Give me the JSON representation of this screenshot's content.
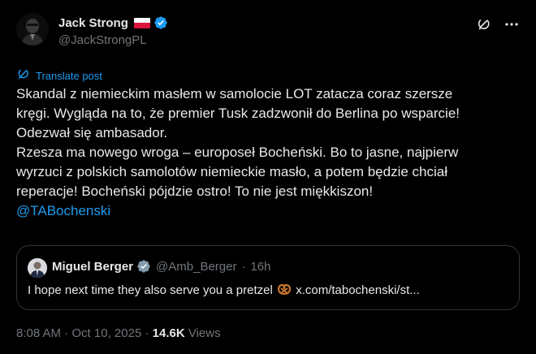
{
  "author": {
    "display_name": "Jack Strong",
    "handle": "@JackStrongPL",
    "flag_icon": "poland-flag-icon",
    "verified_icon": "verified-badge-icon"
  },
  "actions": {
    "grok_icon": "grok-icon",
    "more_icon": "more-options-icon"
  },
  "translate": {
    "label": "Translate post",
    "icon": "translate-icon"
  },
  "post": {
    "lines": [
      "Skandal z niemieckim masłem w samolocie LOT zatacza coraz szersze",
      "kręgi. Wygląda na to, że premier Tusk zadzwonił do Berlina po wsparcie!",
      "Odezwał się ambasador.",
      "Rzesza ma nowego wroga – europoseł Bocheński. Bo to jasne, najpierw",
      "wyrzuci z polskich samolotów niemieckie masło, a potem będzie chciał",
      "reperacje! Bocheński pójdzie ostro! To nie jest miękkiszon!"
    ],
    "mention": "@TABochenski"
  },
  "quote": {
    "display_name": "Miguel Berger",
    "handle": "@Amb_Berger",
    "separator": "·",
    "time": "16h",
    "text_before": "I hope next time they also serve you a pretzel",
    "emoji_icon": "pretzel-emoji-icon",
    "link": "x.com/tabochenski/st..."
  },
  "meta": {
    "time": "8:08 AM",
    "separator1": " · ",
    "date": "Oct 10, 2025",
    "separator2": " · ",
    "views_count": "14.6K",
    "views_label": " Views"
  },
  "colors": {
    "background": "#000000",
    "text": "#e7e9ea",
    "muted": "#71767b",
    "accent": "#1d9bf0",
    "border": "#2f3336",
    "flag_red": "#dc143c"
  }
}
